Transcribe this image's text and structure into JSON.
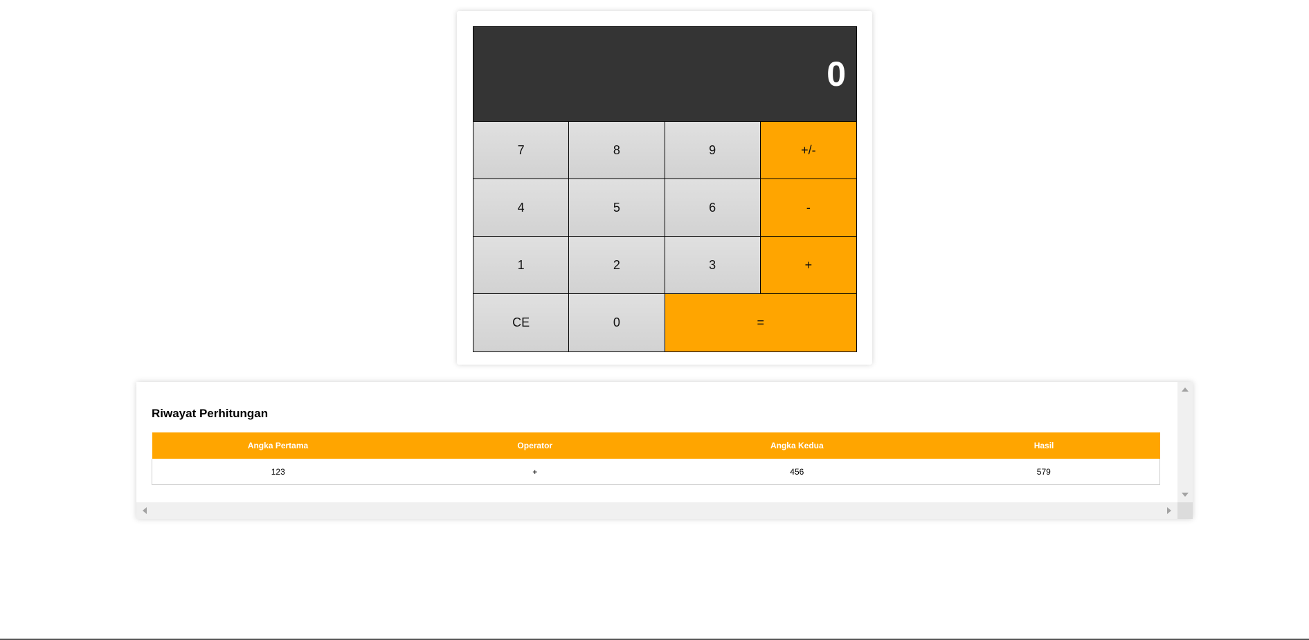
{
  "calculator": {
    "display_value": "0",
    "keys": {
      "k7": "7",
      "k8": "8",
      "k9": "9",
      "plus_minus": "+/-",
      "k4": "4",
      "k5": "5",
      "k6": "6",
      "minus": "-",
      "k1": "1",
      "k2": "2",
      "k3": "3",
      "plus": "+",
      "clear": "CE",
      "k0": "0",
      "equals": "="
    },
    "colors": {
      "display_bg": "#343434",
      "operator_bg": "#ffa500",
      "number_bg": "#d8d8d8"
    }
  },
  "history": {
    "title": "Riwayat Perhitungan",
    "columns": [
      "Angka Pertama",
      "Operator",
      "Angka Kedua",
      "Hasil"
    ],
    "rows": [
      [
        "123",
        "+",
        "456",
        "579"
      ]
    ],
    "header_color": "#ffa500"
  }
}
